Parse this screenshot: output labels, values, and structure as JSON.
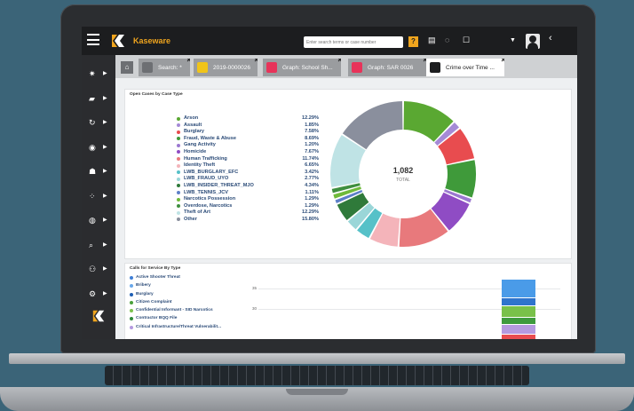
{
  "app": {
    "brand": "Kaseware",
    "search_placeholder": "Enter search terms or case number",
    "help_label": "?"
  },
  "topbar_icons": [
    "document-icon",
    "chat-icon",
    "window-icon",
    "caret-down-icon",
    "user-avatar",
    "chevron-left-icon"
  ],
  "sidebar": {
    "items": [
      {
        "icon": "gear-icon",
        "glyph": "✷"
      },
      {
        "icon": "briefcase-icon",
        "glyph": "▰"
      },
      {
        "icon": "refresh-icon",
        "glyph": "↻"
      },
      {
        "icon": "location-icon",
        "glyph": "◉"
      },
      {
        "icon": "people-icon",
        "glyph": "☗"
      },
      {
        "icon": "scatter-icon",
        "glyph": "⁘"
      },
      {
        "icon": "globe-icon",
        "glyph": "◍"
      },
      {
        "icon": "search-icon",
        "glyph": "⌕"
      },
      {
        "icon": "group-icon",
        "glyph": "⚇"
      },
      {
        "icon": "settings-icon",
        "glyph": "⚙"
      }
    ]
  },
  "tabs": [
    {
      "label": "Search: *",
      "icon_color": "#6d6f73",
      "active": false
    },
    {
      "label": "2019-0000026",
      "icon_color": "#f0c419",
      "active": false
    },
    {
      "label": "Graph: School Sh...",
      "icon_color": "#e8335a",
      "active": false
    },
    {
      "label": "Graph: SAR 0026",
      "icon_color": "#e8335a",
      "active": false
    },
    {
      "label": "Crime over Time ...",
      "icon_color": "#1c1d1f",
      "active": true
    }
  ],
  "open_cases": {
    "title": "Open Cases by Case Type",
    "center_total": "1,082",
    "center_label": "TOTAL"
  },
  "chart_data": {
    "type": "pie",
    "title": "Open Cases by Case Type",
    "total": 1082,
    "categories": [
      "Arson",
      "Assault",
      "Burglary",
      "Fraud, Waste & Abuse",
      "Gang Activity",
      "Homicide",
      "Human Trafficking",
      "Identity Theft",
      "LWB_BURGLARY_EFC",
      "LWB_FRAUD_UYO",
      "LWB_INSIDER_THREAT_MJO",
      "LWB_TENNIS_JCV",
      "Narcotics Possession",
      "Overdose, Narcotics",
      "Theft of Art",
      "Other"
    ],
    "values": [
      12.29,
      1.85,
      7.58,
      8.69,
      1.2,
      7.67,
      11.74,
      6.65,
      3.42,
      2.77,
      4.34,
      1.11,
      1.29,
      1.29,
      12.29,
      15.8
    ],
    "labels": [
      "12.29%",
      "1.85%",
      "7.58%",
      "8.69%",
      "1.20%",
      "7.67%",
      "11.74%",
      "6.65%",
      "3.42%",
      "2.77%",
      "4.34%",
      "1.11%",
      "1.29%",
      "1.29%",
      "12.29%",
      "15.80%"
    ],
    "colors": [
      "#5aa832",
      "#a58ad6",
      "#e84c4f",
      "#3f9a3a",
      "#9b78d0",
      "#8f4cc4",
      "#e8797c",
      "#f4b4ba",
      "#56c1c8",
      "#9ad6d8",
      "#2f7a3a",
      "#5d7fc8",
      "#6fba3a",
      "#3f8f3f",
      "#bfe3e5",
      "#8a8f9d"
    ]
  },
  "calls_for_service": {
    "title": "Calls for Service By Type",
    "items": [
      {
        "name": "Active Shooter Threat",
        "color": "#3f7fd6"
      },
      {
        "name": "Bribery",
        "color": "#6aa8ea"
      },
      {
        "name": "Burglary",
        "color": "#1f5fb4"
      },
      {
        "name": "Citizen Complaint",
        "color": "#4aa13a"
      },
      {
        "name": "Confidential Informant - SID Narcotics",
        "color": "#7cc24e"
      },
      {
        "name": "Contractor BQQ File",
        "color": "#2e8a3a"
      },
      {
        "name": "Critical Infrastructure/Threat Vulnerabilit...",
        "color": "#b59ae0"
      }
    ],
    "y_ticks": [
      "35",
      "30"
    ]
  },
  "stacked_bar_colors": [
    "#4a9be8",
    "#2f74cc",
    "#79c14a",
    "#3e9a3e",
    "#b59ae0",
    "#e84c4f"
  ]
}
